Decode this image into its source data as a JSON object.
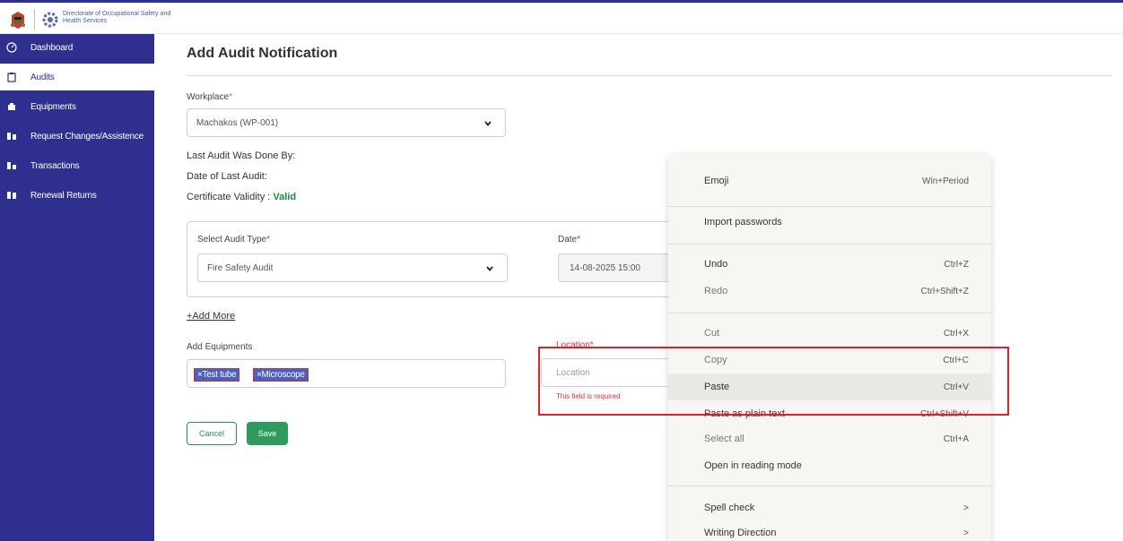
{
  "header": {
    "org_name": "Directorate of Occupational Safety and Health Services"
  },
  "sidebar": {
    "items": [
      {
        "label": "Dashboard",
        "icon": "gauge-icon",
        "active": false
      },
      {
        "label": "Audits",
        "icon": "clipboard-icon",
        "active": true
      },
      {
        "label": "Equipments",
        "icon": "equipment-icon",
        "active": false
      },
      {
        "label": "Request Changes/Assistence",
        "icon": "request-icon",
        "active": false
      },
      {
        "label": "Transactions",
        "icon": "transactions-icon",
        "active": false
      },
      {
        "label": "Renewal Returns",
        "icon": "renewal-icon",
        "active": false
      }
    ]
  },
  "form": {
    "title": "Add Audit Notification",
    "workplace_label": "Workplace",
    "workplace_value": "Machakos (WP-001)",
    "last_audit_by": "Last Audit Was Done By:",
    "date_last_audit": "Date of Last Audit:",
    "cert_validity_label": "Certificate Validity :",
    "cert_validity_value": "Valid",
    "audit_type_label": "Select Audit Type",
    "audit_type_value": "Fire Safety Audit",
    "date_label": "Date",
    "date_value": "14-08-2025 15:00",
    "add_more": "+Add More",
    "equipments_label": "Add Equipments",
    "equipments": [
      "×Test tube",
      "×Microscope"
    ],
    "location_label": "Location",
    "location_placeholder": "Location",
    "location_error": "This field is required",
    "cancel_label": "Cancel",
    "save_label": "Save",
    "required_mark": "*"
  },
  "context_menu": {
    "items": [
      {
        "label": "Emoji",
        "shortcut": "Win+Period"
      },
      {
        "label": "Import passwords",
        "shortcut": ""
      },
      {
        "label": "Undo",
        "shortcut": "Ctrl+Z"
      },
      {
        "label": "Redo",
        "shortcut": "Ctrl+Shift+Z"
      },
      {
        "label": "Cut",
        "shortcut": "Ctrl+X"
      },
      {
        "label": "Copy",
        "shortcut": "Ctrl+C"
      },
      {
        "label": "Paste",
        "shortcut": "Ctrl+V"
      },
      {
        "label": "Paste as plain text",
        "shortcut": "Ctrl+Shift+V"
      },
      {
        "label": "Select all",
        "shortcut": "Ctrl+A"
      },
      {
        "label": "Open in reading mode",
        "shortcut": ""
      },
      {
        "label": "Spell check",
        "shortcut": ">"
      },
      {
        "label": "Writing Direction",
        "shortcut": ">"
      }
    ]
  },
  "colors": {
    "sidebar_bg": "#2f2f8f",
    "highlight_box": "#e0202a",
    "valid_green": "#1d8a3a",
    "save_green": "#2e9a5e"
  }
}
